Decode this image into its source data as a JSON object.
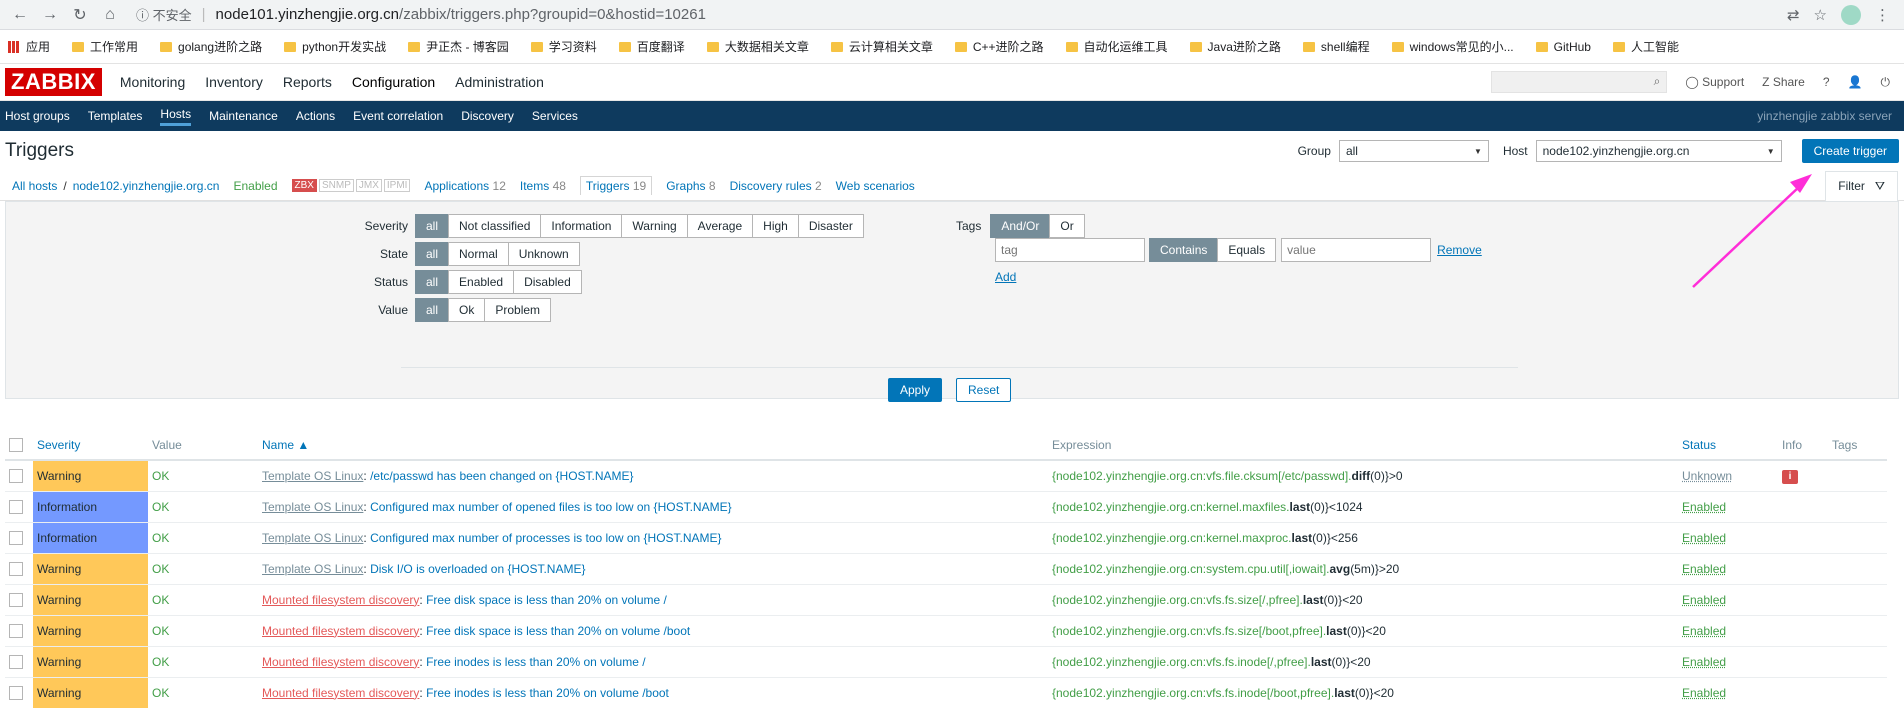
{
  "browser": {
    "insecure_label": "不安全",
    "url_host": "node101.yinzhengjie.org.cn",
    "url_path": "/zabbix/triggers.php?groupid=0&hostid=10261",
    "bookmarks": [
      "应用",
      "工作常用",
      "golang进阶之路",
      "python开发实战",
      "尹正杰 - 博客园",
      "学习资料",
      "百度翻译",
      "大数据相关文章",
      "云计算相关文章",
      "C++进阶之路",
      "自动化运维工具",
      "Java进阶之路",
      "shell编程",
      "windows常见的小...",
      "GitHub",
      "人工智能"
    ]
  },
  "header": {
    "logo": "ZABBIX",
    "menu": [
      "Monitoring",
      "Inventory",
      "Reports",
      "Configuration",
      "Administration"
    ],
    "support": "Support",
    "share": "Share",
    "help": "?",
    "server_name": "yinzhengjie zabbix server"
  },
  "subnav": [
    "Host groups",
    "Templates",
    "Hosts",
    "Maintenance",
    "Actions",
    "Event correlation",
    "Discovery",
    "Services"
  ],
  "title": {
    "text": "Triggers",
    "group_label": "Group",
    "group_value": "all",
    "host_label": "Host",
    "host_value": "node102.yinzhengjie.org.cn",
    "create_button": "Create trigger"
  },
  "host_tabs": {
    "all_hosts": "All hosts",
    "slash": "/",
    "host": "node102.yinzhengjie.org.cn",
    "enabled": "Enabled",
    "zbx": "ZBX",
    "snmp": "SNMP",
    "jmx": "JMX",
    "ipmi": "IPMI",
    "applications": "Applications",
    "applications_count": "12",
    "items": "Items",
    "items_count": "48",
    "triggers": "Triggers",
    "triggers_count": "19",
    "graphs": "Graphs",
    "graphs_count": "8",
    "discovery": "Discovery rules",
    "discovery_count": "2",
    "web": "Web scenarios",
    "filter": "Filter"
  },
  "filter": {
    "severity_label": "Severity",
    "severity": [
      "all",
      "Not classified",
      "Information",
      "Warning",
      "Average",
      "High",
      "Disaster"
    ],
    "state_label": "State",
    "state": [
      "all",
      "Normal",
      "Unknown"
    ],
    "status_label": "Status",
    "status": [
      "all",
      "Enabled",
      "Disabled"
    ],
    "value_label": "Value",
    "value": [
      "all",
      "Ok",
      "Problem"
    ],
    "tags_label": "Tags",
    "tags_mode": [
      "And/Or",
      "Or"
    ],
    "tag_placeholder": "tag",
    "tag_op": [
      "Contains",
      "Equals"
    ],
    "value_placeholder": "value",
    "remove": "Remove",
    "add": "Add",
    "apply": "Apply",
    "reset": "Reset"
  },
  "table": {
    "headers": {
      "severity": "Severity",
      "value": "Value",
      "name": "Name ▲",
      "expression": "Expression",
      "status": "Status",
      "info": "Info",
      "tags": "Tags"
    },
    "rows": [
      {
        "severity": "Warning",
        "value": "OK",
        "source": "Template OS Linux",
        "name": "/etc/passwd has been changed on {HOST.NAME}",
        "expr_host": "{node102.yinzhengjie.org.cn:vfs.file.cksum[/etc/passwd].",
        "expr_fn": "diff",
        "expr_rest": "(0)}>0",
        "status": "Unknown",
        "info": "i"
      },
      {
        "severity": "Information",
        "value": "OK",
        "source": "Template OS Linux",
        "name": "Configured max number of opened files is too low on {HOST.NAME}",
        "expr_host": "{node102.yinzhengjie.org.cn:kernel.maxfiles.",
        "expr_fn": "last",
        "expr_rest": "(0)}<1024",
        "status": "Enabled",
        "info": ""
      },
      {
        "severity": "Information",
        "value": "OK",
        "source": "Template OS Linux",
        "name": "Configured max number of processes is too low on {HOST.NAME}",
        "expr_host": "{node102.yinzhengjie.org.cn:kernel.maxproc.",
        "expr_fn": "last",
        "expr_rest": "(0)}<256",
        "status": "Enabled",
        "info": ""
      },
      {
        "severity": "Warning",
        "value": "OK",
        "source": "Template OS Linux",
        "name": "Disk I/O is overloaded on {HOST.NAME}",
        "expr_host": "{node102.yinzhengjie.org.cn:system.cpu.util[,iowait].",
        "expr_fn": "avg",
        "expr_rest": "(5m)}>20",
        "status": "Enabled",
        "info": ""
      },
      {
        "severity": "Warning",
        "value": "OK",
        "source": "Mounted filesystem discovery",
        "name": "Free disk space is less than 20% on volume /",
        "expr_host": "{node102.yinzhengjie.org.cn:vfs.fs.size[/,pfree].",
        "expr_fn": "last",
        "expr_rest": "(0)}<20",
        "status": "Enabled",
        "info": ""
      },
      {
        "severity": "Warning",
        "value": "OK",
        "source": "Mounted filesystem discovery",
        "name": "Free disk space is less than 20% on volume /boot",
        "expr_host": "{node102.yinzhengjie.org.cn:vfs.fs.size[/boot,pfree].",
        "expr_fn": "last",
        "expr_rest": "(0)}<20",
        "status": "Enabled",
        "info": ""
      },
      {
        "severity": "Warning",
        "value": "OK",
        "source": "Mounted filesystem discovery",
        "name": "Free inodes is less than 20% on volume /",
        "expr_host": "{node102.yinzhengjie.org.cn:vfs.fs.inode[/,pfree].",
        "expr_fn": "last",
        "expr_rest": "(0)}<20",
        "status": "Enabled",
        "info": ""
      },
      {
        "severity": "Warning",
        "value": "OK",
        "source": "Mounted filesystem discovery",
        "name": "Free inodes is less than 20% on volume /boot",
        "expr_host": "{node102.yinzhengjie.org.cn:vfs.fs.inode[/boot,pfree].",
        "expr_fn": "last",
        "expr_rest": "(0)}<20",
        "status": "Enabled",
        "info": ""
      }
    ]
  }
}
